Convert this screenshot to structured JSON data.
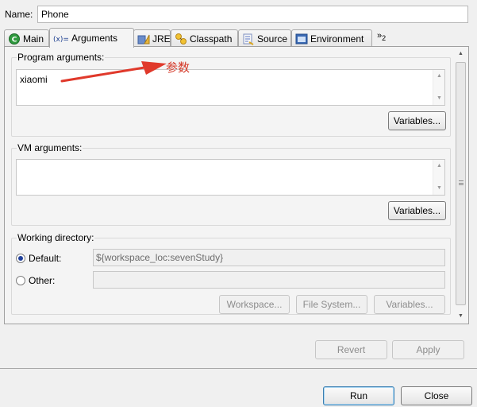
{
  "name": {
    "label": "Name:",
    "value": "Phone"
  },
  "tabs": [
    {
      "label": "Main",
      "icon": "main-icon"
    },
    {
      "label": "Arguments",
      "icon": "arguments-icon"
    },
    {
      "label": "JRE",
      "icon": "jre-icon"
    },
    {
      "label": "Classpath",
      "icon": "classpath-icon"
    },
    {
      "label": "Source",
      "icon": "source-icon"
    },
    {
      "label": "Environment",
      "icon": "environment-icon"
    }
  ],
  "tab_overflow": {
    "glyph": "»",
    "count": "2"
  },
  "program_args": {
    "title": "Program arguments:",
    "value": "xiaomi",
    "variables_label": "Variables..."
  },
  "vm_args": {
    "title": "VM arguments:",
    "value": "",
    "variables_label": "Variables..."
  },
  "working_dir": {
    "title": "Working directory:",
    "default_label": "Default:",
    "default_value": "${workspace_loc:sevenStudy}",
    "other_label": "Other:",
    "other_value": "",
    "selected": "default",
    "workspace_label": "Workspace...",
    "filesystem_label": "File System...",
    "variables_label": "Variables..."
  },
  "actions": {
    "revert": "Revert",
    "apply": "Apply",
    "run": "Run",
    "close": "Close"
  },
  "annotation": {
    "text": "参数",
    "color": "#d43a2a"
  },
  "colors": {
    "default_button_border": "#3c7fb1",
    "radio_dot": "#1f3f9a"
  }
}
